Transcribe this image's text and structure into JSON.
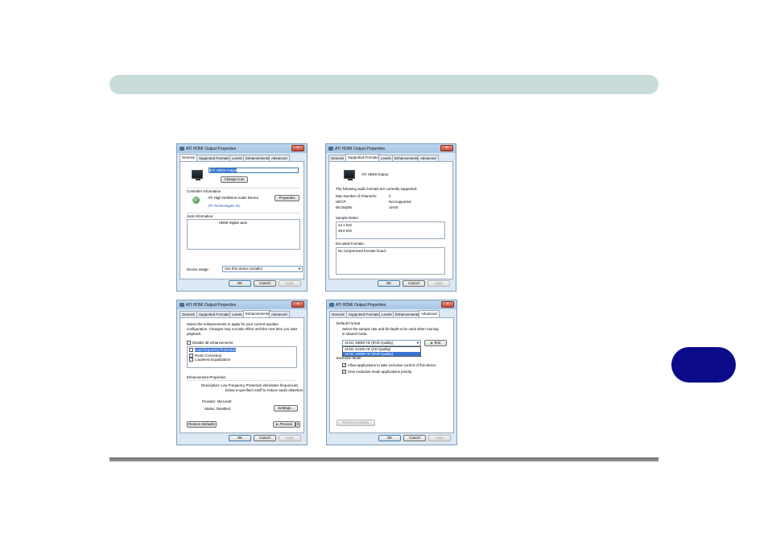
{
  "page": {
    "accent": "#0b0b8a",
    "header_color": "#c9dcd9"
  },
  "dialogs": {
    "general": {
      "title": "ATI HDMI Output Properties",
      "tabs": [
        "General",
        "Supported Formats",
        "Levels",
        "Enhancements",
        "Advanced"
      ],
      "device_name": "ATI HDMI Output",
      "change_icon": "Change Icon",
      "controller_header": "Controller Information",
      "controller_name": "ATI High Definition Audio Device",
      "controller_vendor": "ATI Technologies Inc.",
      "properties": "Properties",
      "jack_header": "Jack Information",
      "jack_value": "HDMI Digital Jack",
      "device_usage_label": "Device usage:",
      "device_usage_value": "Use this device (enable)",
      "ok": "OK",
      "cancel": "Cancel",
      "apply": "Apply"
    },
    "formats": {
      "title": "ATI HDMI Output Properties",
      "tabs": [
        "General",
        "Supported Formats",
        "Levels",
        "Enhancements",
        "Advanced"
      ],
      "device_name": "ATI HDMI Output",
      "intro": "The following audio formats are currently supported:",
      "rows": [
        {
          "label": "Max Number of Channels:",
          "value": "2"
        },
        {
          "label": "HDCP:",
          "value": "Not supported"
        },
        {
          "label": "Bit Depths:",
          "value": "16-bit"
        }
      ],
      "sample_rates_header": "Sample Rates:",
      "sample_rates": [
        "44.1 kHz",
        "48.0 kHz"
      ],
      "encoded_header": "Encoded Formats:",
      "encoded_value": "No compressed formats found.",
      "ok": "OK",
      "cancel": "Cancel",
      "apply": "Apply"
    },
    "enhancements": {
      "title": "ATI HDMI Output Properties",
      "tabs": [
        "General",
        "Supported Formats",
        "Levels",
        "Enhancements",
        "Advanced"
      ],
      "intro_1": "Select the enhancements to apply for your current speaker",
      "intro_2": "configuration. Changes may not take effect until the next time you start",
      "intro_3": "playback.",
      "disable_all": "Disable all enhancements",
      "items": [
        "Low Frequency Protection",
        "Room Correction",
        "Loudness Equalization"
      ],
      "props_header": "Enhancement Properties",
      "desc_1": "Description: Low Frequency Protection eliminates frequencies",
      "desc_2": "below a specified cutoff to reduce audio distortion.",
      "provider": "Provider: Microsoft",
      "status": "Status: Disabled",
      "settings": "Settings...",
      "restore": "Restore Defaults",
      "preview": "Preview",
      "ok": "OK",
      "cancel": "Cancel",
      "apply": "Apply"
    },
    "advanced": {
      "title": "ATI HDMI Output Properties",
      "tabs": [
        "General",
        "Supported Formats",
        "Levels",
        "Enhancements",
        "Advanced"
      ],
      "default_format_header": "Default Format",
      "default_format_desc_1": "Select the sample rate and bit depth to be used when running",
      "default_format_desc_2": "in shared mode.",
      "selected_format": "16 bit, 48000 Hz (DVD Quality)",
      "options": [
        "16 bit, 44100 Hz (CD Quality)",
        "16 bit, 48000 Hz (DVD Quality)"
      ],
      "test": "Test",
      "exclusive_header": "Exclusive Mode",
      "exclusive_1": "Allow applications to take exclusive control of this device",
      "exclusive_2": "Give exclusive mode applications priority",
      "restore": "Restore Defaults",
      "ok": "OK",
      "cancel": "Cancel",
      "apply": "Apply"
    }
  }
}
